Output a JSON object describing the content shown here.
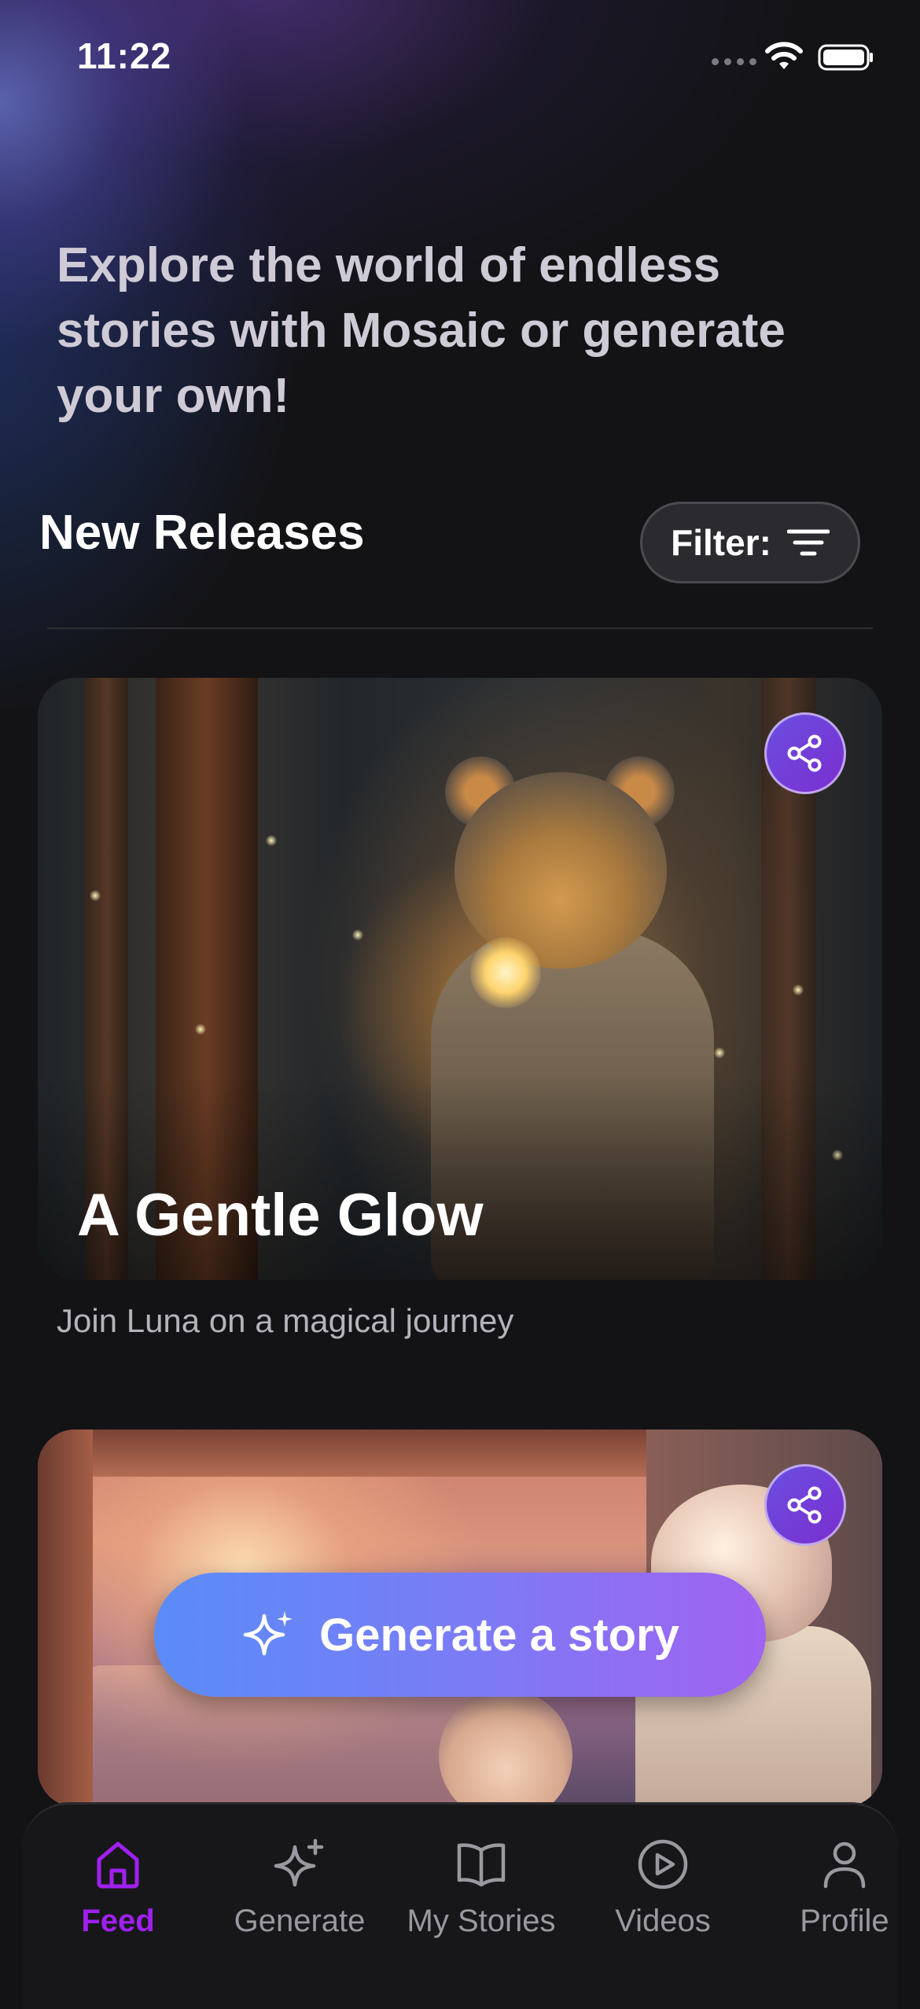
{
  "status_bar": {
    "time": "11:22"
  },
  "hero": {
    "text": "Explore the world of endless stories with Mosaic or generate your own!"
  },
  "section": {
    "title": "New Releases",
    "filter_label": "Filter:"
  },
  "feed": [
    {
      "title": "A Gentle Glow",
      "subtitle": "Join Luna on a magical journey"
    },
    {
      "title": "",
      "subtitle": ""
    }
  ],
  "generate_button": {
    "label": "Generate a story"
  },
  "tab_bar": {
    "active": "Feed",
    "tabs": [
      {
        "label": "Feed",
        "icon": "home-icon"
      },
      {
        "label": "Generate",
        "icon": "sparkles-icon"
      },
      {
        "label": "My Stories",
        "icon": "book-icon"
      },
      {
        "label": "Videos",
        "icon": "play-circle-icon"
      },
      {
        "label": "Profile",
        "icon": "person-icon"
      }
    ]
  },
  "colors": {
    "accent": "#a020f0",
    "generate_start": "#5a8cf8",
    "generate_end": "#a063f1",
    "background": "#131316"
  }
}
